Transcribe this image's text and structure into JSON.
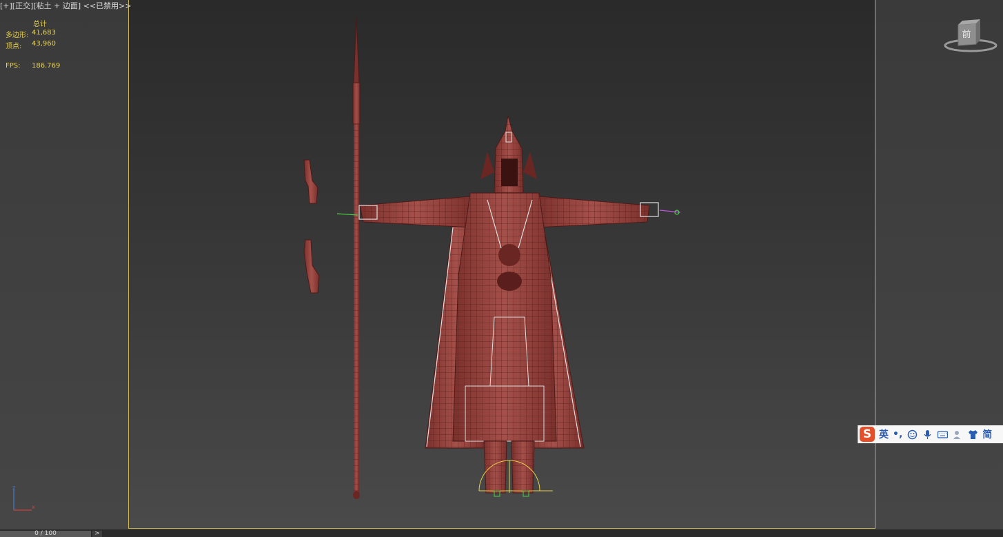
{
  "viewport": {
    "label": "[+][正交][粘土 + 边面] <<已禁用>>"
  },
  "stats": {
    "header": "总计",
    "polys_label": "多边形:",
    "polys_value": "41,683",
    "verts_label": "顶点:",
    "verts_value": "43,960",
    "fps_label": "FPS:",
    "fps_value": "186.769"
  },
  "viewcube": {
    "face_label": "前"
  },
  "timeline": {
    "frame_text": "0 / 100",
    "next_glyph": ">"
  },
  "ime": {
    "logo": "S",
    "lang": "英",
    "punct": "•,",
    "mode": "简"
  },
  "axis": {
    "x": "x",
    "z": "z"
  },
  "colors": {
    "safe_frame": "#c8b24a",
    "model_fill": "#8a3a36",
    "wire": "#5a1e1c",
    "stats_text": "#e8d04a"
  }
}
